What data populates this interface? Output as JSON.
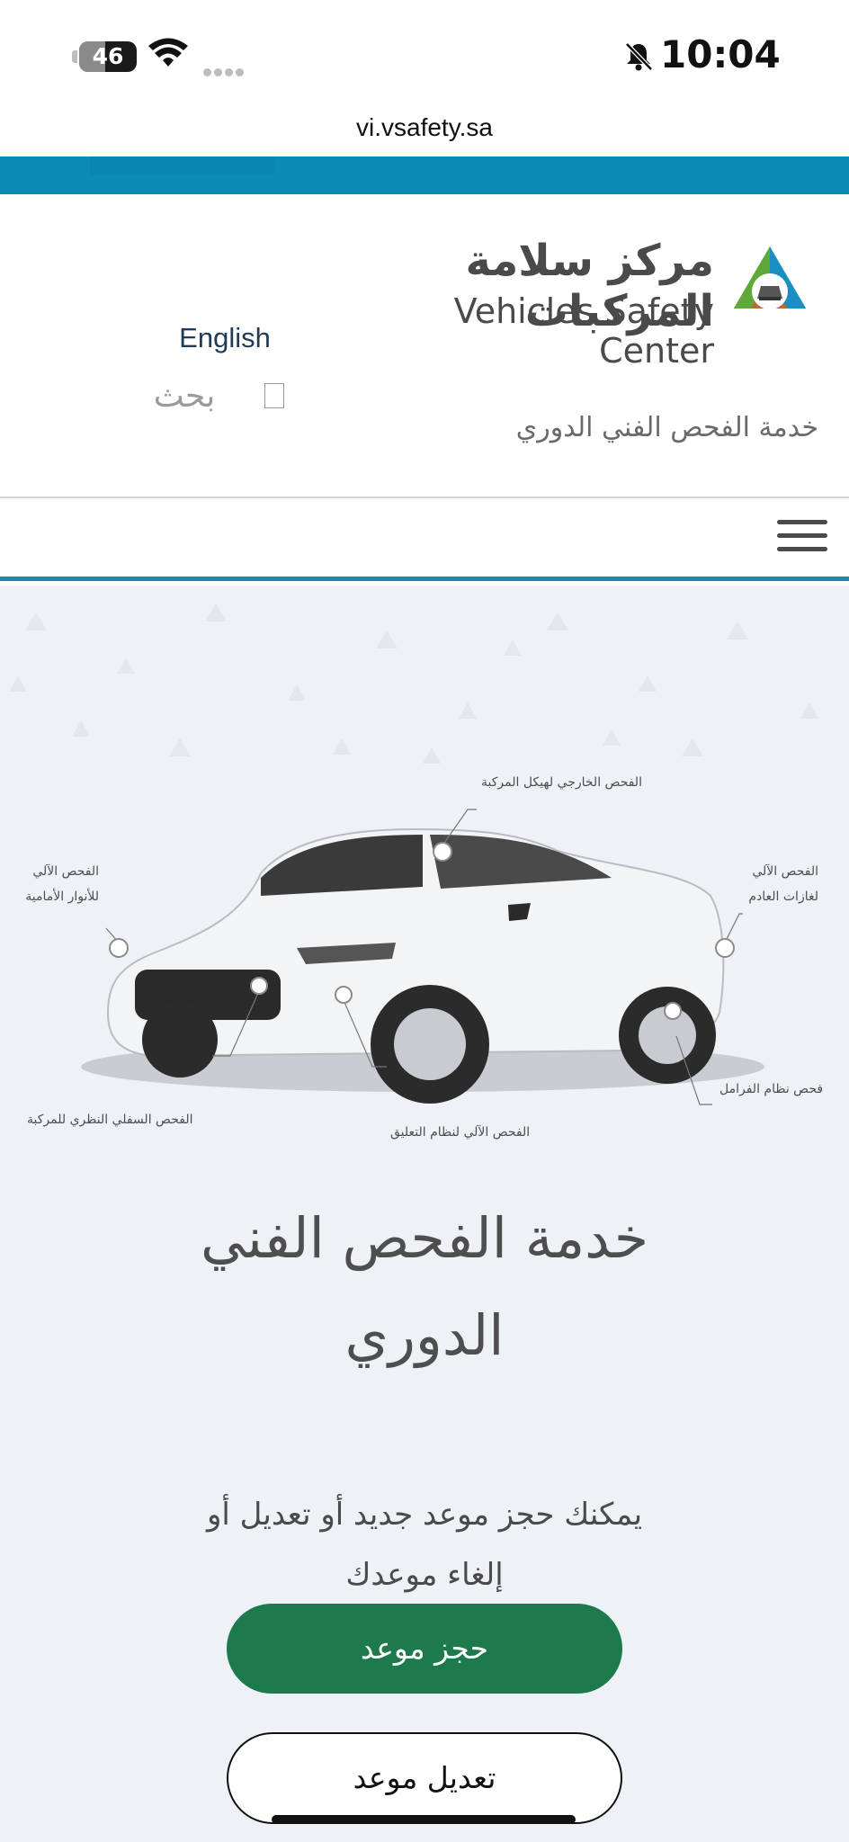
{
  "status_bar": {
    "battery": "46",
    "battery_level": 0.46,
    "time": "10:04",
    "icons": [
      "battery-icon",
      "wifi-icon",
      "cellular-signal-icon",
      "silent-bell-icon"
    ]
  },
  "browser": {
    "url": "vi.vsafety.sa"
  },
  "header": {
    "logo_ar": "مركز سلامة المركبات",
    "logo_en": "Vehicles Safety Center",
    "language_link": "English",
    "search_label": "بحث",
    "service_title": "خدمة الفحص الفني الدوري"
  },
  "colors": {
    "brand_blue": "#0b8cb7",
    "brand_green": "#1d7a4d",
    "logo_blue": "#1b8fc1",
    "logo_green": "#5fa83a",
    "logo_brown": "#b8693a"
  },
  "hero": {
    "callouts": {
      "body": "الفحص الخارجي لهيكل المركبة",
      "lights_1": "الفحص الآلي",
      "lights_2": "للأنوار الأمامية",
      "exhaust_1": "الفحص الآلي",
      "exhaust_2": "لغازات العادم",
      "brakes": "فحص نظام الفرامل",
      "underbody": "الفحص السفلي النظري للمركبة",
      "suspension": "الفحص الآلي لنظام التعليق"
    },
    "title": "خدمة الفحص الفني الدوري",
    "subtitle": "يمكنك حجز موعد جديد أو تعديل أو إلغاء موعدك",
    "book_button": "حجز موعد",
    "edit_button": "تعديل موعد"
  }
}
